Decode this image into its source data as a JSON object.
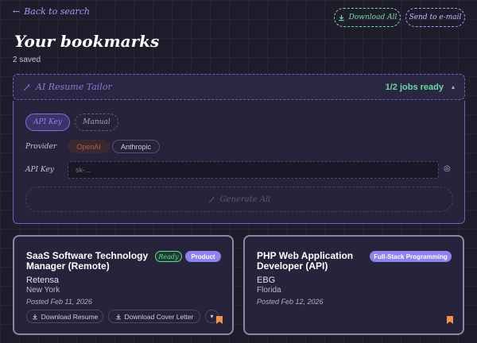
{
  "header": {
    "back_label": "Back to search",
    "download_all": "Download All",
    "send_email": "Send to e-mail",
    "title": "Your bookmarks",
    "count": "2 saved"
  },
  "tailor": {
    "label": "AI Resume Tailor",
    "status": "1/2 jobs ready",
    "tabs": {
      "api_key": "API Key",
      "manual": "Manual"
    },
    "provider_label": "Provider",
    "providers": {
      "openai": "OpenAI",
      "anthropic": "Anthropic"
    },
    "api_key_label": "API Key",
    "api_key_placeholder": "sk-...",
    "generate_all": "Generate All"
  },
  "cards": [
    {
      "title_line1": "SaaS Software Technology",
      "title_line2": "Manager (Remote)",
      "company": "Retensa",
      "location": "New York",
      "posted": "Posted Feb 11, 2026",
      "status_tag": "Ready",
      "category": "Product",
      "download_resume": "Download Resume",
      "download_cover": "Download Cover Letter"
    },
    {
      "title_line1": "PHP Web Application",
      "title_line2": "Developer (API)",
      "company": "EBG",
      "location": "Florida",
      "posted": "Posted Feb 12, 2026",
      "category": "Full-Stack Programming"
    }
  ],
  "colors": {
    "accent": "#8e82f2",
    "success": "#5ddf9b",
    "bookmark": "#f0904a",
    "background": "#1f1c2c"
  }
}
